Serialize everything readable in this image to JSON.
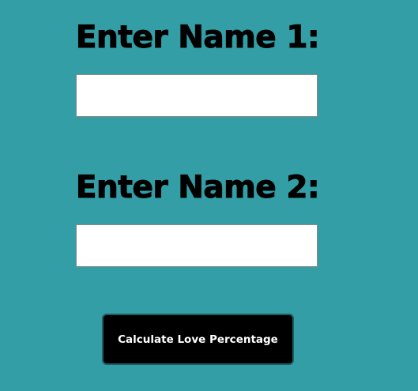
{
  "form": {
    "name1_label": "Enter Name 1:",
    "name1_value": "",
    "name1_placeholder": "",
    "name2_label": "Enter Name 2:",
    "name2_value": "",
    "name2_placeholder": "",
    "submit_label": "Calculate Love Percentage"
  },
  "colors": {
    "background": "#339ea6",
    "button": "#000000",
    "button_text": "#ffffff",
    "input_background": "#ffffff"
  }
}
